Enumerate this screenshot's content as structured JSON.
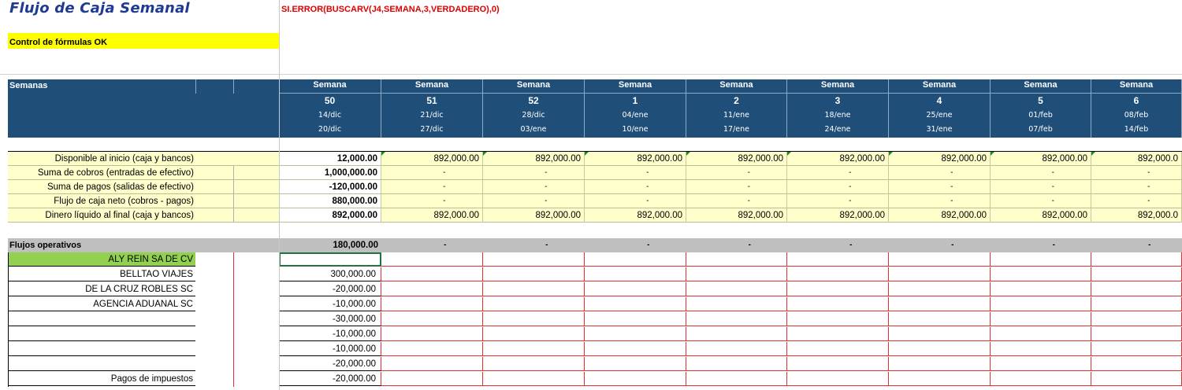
{
  "title": "Flujo de Caja Semanal",
  "formula": "SI.ERROR(BUSCARV(J4,SEMANA,3,VERDADERO),0)",
  "status": "Control de fórmulas OK",
  "header": {
    "label": "Semanas",
    "weeks": [
      {
        "label": "Semana",
        "num": "50",
        "from": "14/dic",
        "to": "20/dic"
      },
      {
        "label": "Semana",
        "num": "51",
        "from": "21/dic",
        "to": "27/dic"
      },
      {
        "label": "Semana",
        "num": "52",
        "from": "28/dic",
        "to": "03/ene"
      },
      {
        "label": "Semana",
        "num": "1",
        "from": "04/ene",
        "to": "10/ene"
      },
      {
        "label": "Semana",
        "num": "2",
        "from": "11/ene",
        "to": "17/ene"
      },
      {
        "label": "Semana",
        "num": "3",
        "from": "18/ene",
        "to": "24/ene"
      },
      {
        "label": "Semana",
        "num": "4",
        "from": "25/ene",
        "to": "31/ene"
      },
      {
        "label": "Semana",
        "num": "5",
        "from": "01/feb",
        "to": "07/feb"
      },
      {
        "label": "Semana",
        "num": "6",
        "from": "08/feb",
        "to": "14/feb"
      }
    ]
  },
  "summary": [
    {
      "label": "Disponible al inicio (caja y bancos)",
      "values": [
        "12,000.00",
        "892,000.00",
        "892,000.00",
        "892,000.00",
        "892,000.00",
        "892,000.00",
        "892,000.00",
        "892,000.00",
        "892,000.0"
      ]
    },
    {
      "label": "Suma de cobros (entradas de efectivo)",
      "values": [
        "1,000,000.00",
        "-",
        "-",
        "-",
        "-",
        "-",
        "-",
        "-",
        "-"
      ]
    },
    {
      "label": "Suma de pagos (salidas de efectivo)",
      "values": [
        "-120,000.00",
        "-",
        "-",
        "-",
        "-",
        "-",
        "-",
        "-",
        "-"
      ]
    },
    {
      "label": "Flujo de caja neto (cobros - pagos)",
      "values": [
        "880,000.00",
        "-",
        "-",
        "-",
        "-",
        "-",
        "-",
        "-",
        "-"
      ]
    },
    {
      "label": "Dinero líquido al final (caja y bancos)",
      "values": [
        "892,000.00",
        "892,000.00",
        "892,000.00",
        "892,000.00",
        "892,000.00",
        "892,000.00",
        "892,000.00",
        "892,000.00",
        "892,000.0"
      ]
    }
  ],
  "operative": {
    "label": "Flujos operativos",
    "values": [
      "180,000.00",
      "-",
      "-",
      "-",
      "-",
      "-",
      "-",
      "-",
      "-"
    ],
    "rows": [
      {
        "name": "ALY REIN SA DE CV",
        "value": ""
      },
      {
        "name": "BELLTAO VIAJES",
        "value": "300,000.00"
      },
      {
        "name": "DE LA CRUZ ROBLES SC",
        "value": "-20,000.00"
      },
      {
        "name": "AGENCIA ADUANAL SC",
        "value": "-10,000.00"
      },
      {
        "name": "",
        "value": "-30,000.00"
      },
      {
        "name": "",
        "value": "-10,000.00"
      },
      {
        "name": "",
        "value": "-10,000.00"
      },
      {
        "name": "",
        "value": "-20,000.00"
      },
      {
        "name": "Pagos de impuestos",
        "value": "-20,000.00"
      }
    ]
  },
  "colors": {
    "header_bg": "#1f4e79",
    "yellow_fill": "#ffffcc",
    "status_fill": "#ffff00",
    "green_fill": "#92d050",
    "formula_red": "#e00000"
  }
}
